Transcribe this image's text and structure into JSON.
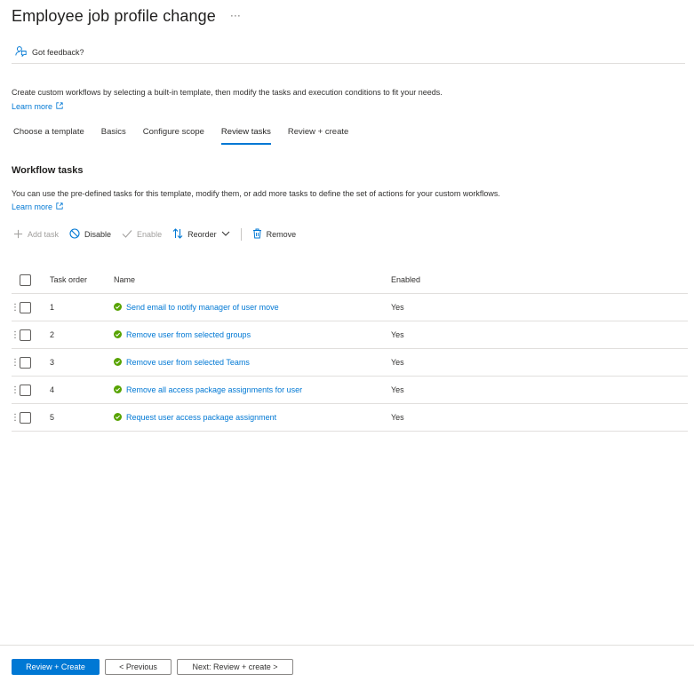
{
  "header": {
    "title": "Employee job profile change",
    "more": "···"
  },
  "command_bar": {
    "feedback_label": "Got feedback?"
  },
  "intro": {
    "description": "Create custom workflows by selecting a built-in template, then modify the tasks and execution conditions to fit your needs.",
    "learn_more": "Learn more"
  },
  "tabs": [
    {
      "label": "Choose a template",
      "active": false
    },
    {
      "label": "Basics",
      "active": false
    },
    {
      "label": "Configure scope",
      "active": false
    },
    {
      "label": "Review tasks",
      "active": true
    },
    {
      "label": "Review + create",
      "active": false
    }
  ],
  "section": {
    "title": "Workflow tasks",
    "description": "You can use the pre-defined tasks for this template, modify them, or add more tasks to define the set of actions for your custom workflows.",
    "learn_more": "Learn more"
  },
  "toolbar": {
    "add_task": "Add task",
    "disable": "Disable",
    "enable": "Enable",
    "reorder": "Reorder",
    "remove": "Remove"
  },
  "grid": {
    "columns": {
      "order": "Task order",
      "name": "Name",
      "enabled": "Enabled"
    },
    "rows": [
      {
        "order": "1",
        "name": "Send email to notify manager of user move",
        "enabled": "Yes"
      },
      {
        "order": "2",
        "name": "Remove user from selected groups",
        "enabled": "Yes"
      },
      {
        "order": "3",
        "name": "Remove user from selected Teams",
        "enabled": "Yes"
      },
      {
        "order": "4",
        "name": "Remove all access package assignments for user",
        "enabled": "Yes"
      },
      {
        "order": "5",
        "name": "Request user access package assignment",
        "enabled": "Yes"
      }
    ]
  },
  "footer": {
    "primary": "Review + Create",
    "previous": "< Previous",
    "next": "Next: Review + create >"
  },
  "colors": {
    "accent": "#0078d4",
    "success": "#57a300",
    "text": "#323130",
    "border": "#e1dfdd"
  }
}
